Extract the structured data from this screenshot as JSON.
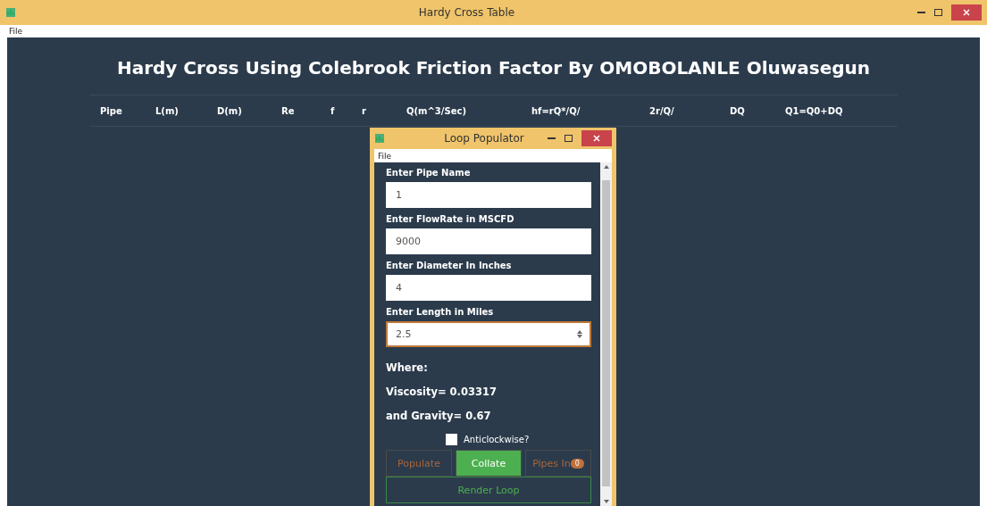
{
  "window": {
    "title": "Hardy Cross Table"
  },
  "menu": [
    "File"
  ],
  "heading": "Hardy Cross Using Colebrook Friction Factor By OMOBOLANLE Oluwasegun",
  "table": {
    "columns": [
      "Pipe",
      "L(m)",
      "D(m)",
      "Re",
      "f",
      "r",
      "Q(m^3/Sec)",
      "hf=rQ*/Q/",
      "2r/Q/",
      "DQ",
      "Q1=Q0+DQ"
    ]
  },
  "dialog": {
    "title": "Loop Populator",
    "menu": [
      "File"
    ],
    "fields": [
      {
        "label": "Enter Pipe Name",
        "value": "1",
        "kind": "text",
        "focused": false
      },
      {
        "label": "Enter FlowRate in MSCFD",
        "value": "9000",
        "kind": "text",
        "focused": false
      },
      {
        "label": "Enter Diameter In Inches",
        "value": "4",
        "kind": "text",
        "focused": false
      },
      {
        "label": "Enter Length in Miles",
        "value": "2.5",
        "kind": "spinner",
        "focused": true
      }
    ],
    "notes": [
      "Where:",
      "Viscosity= 0.03317",
      "and Gravity= 0.67"
    ],
    "checkbox": {
      "label": "Anticlockwise?",
      "checked": false
    },
    "tabs": [
      {
        "label": "Populate",
        "selected": false
      },
      {
        "label": "Collate",
        "selected": true
      },
      {
        "label": "Pipes In",
        "selected": false,
        "badge": "0"
      }
    ],
    "button": "Render Loop"
  }
}
